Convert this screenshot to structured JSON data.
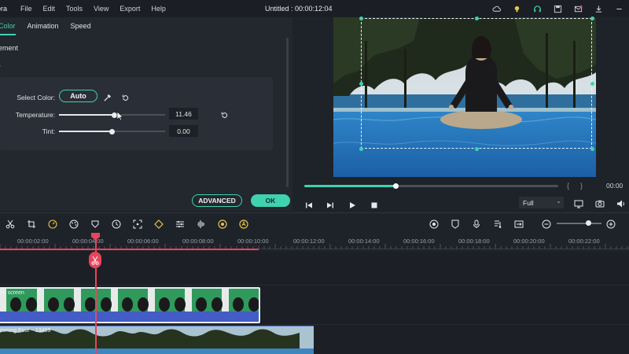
{
  "app": {
    "brand_partial": "ora",
    "title": "Untitled : 00:00:12:04",
    "menu": [
      "File",
      "Edit",
      "Tools",
      "View",
      "Export",
      "Help"
    ]
  },
  "panel": {
    "tabs": [
      "Color",
      "Animation",
      "Speed"
    ],
    "active_tab": "Color",
    "section_label": "ement",
    "select_color_label": "Select Color:",
    "auto_label": "Auto",
    "temperature_label": "Temperature:",
    "temperature_value": "11.46",
    "temperature_level": 0.52,
    "tint_label": "Tint:",
    "tint_value": "0.00",
    "tint_level": 0.5,
    "advanced_label": "ADVANCED",
    "ok_label": "OK"
  },
  "preview": {
    "progress": 0.36,
    "time_readout": "00:00",
    "quality": "Full"
  },
  "timeline": {
    "ticks": [
      "00:00:02:00",
      "00:00:04:00",
      "00:00:06:00",
      "00:00:08:00",
      "00:00:10:00",
      "00:00:12:00",
      "00:00:14:00",
      "00:00:16:00",
      "00:00:18:00",
      "00:00:20:00",
      "00:00:22:00"
    ],
    "clip1_label": "en screen",
    "clip2_label": "mming Pool ~ 13459"
  },
  "colors": {
    "accent": "#3fd2b1",
    "playhead": "#e8455b",
    "panel_bg": "#23272e",
    "app_bg": "#1e2229"
  }
}
